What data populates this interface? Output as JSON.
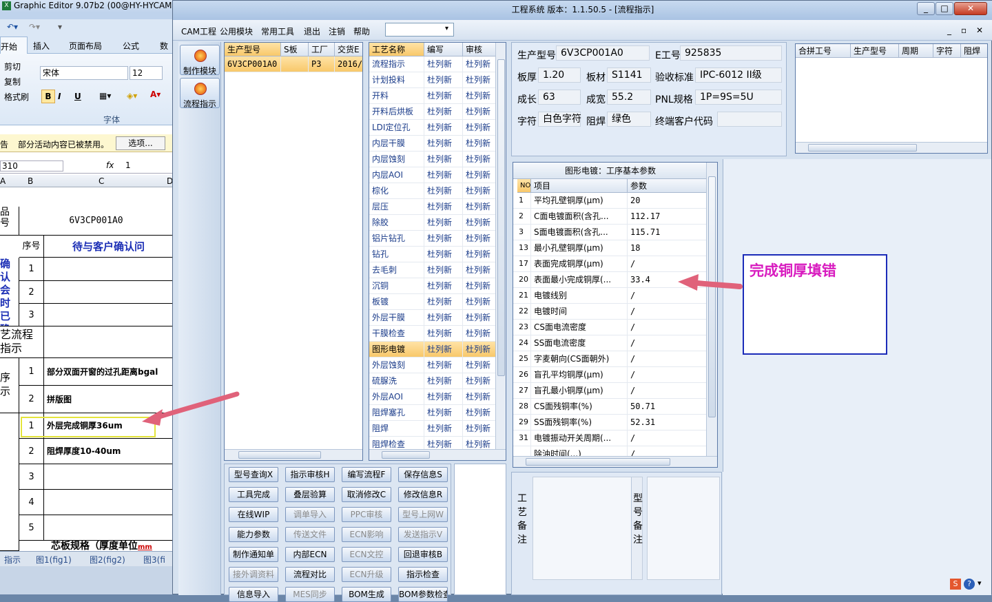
{
  "excel": {
    "title": "Graphic Editor 9.07b2 (00@HY-HYCAM",
    "tabs": [
      "开始",
      "插入",
      "页面布局",
      "公式",
      "数"
    ],
    "clipboard": [
      "剪切",
      "复制",
      "格式刷"
    ],
    "font_name": "宋体",
    "font_size": "12",
    "font_group": "字体",
    "security_msg_prefix": "告",
    "security_msg": "部分活动内容已被禁用。",
    "options_btn": "选项...",
    "namebox": "310",
    "fx": "fx",
    "formula": "1",
    "col_headers": [
      "A",
      "B",
      "C",
      "D"
    ],
    "product_label": "品号",
    "product_value": "6V3CP001A0",
    "seq_header": "序号",
    "pending_header": "待与客户确认问",
    "confirm_label": "确认会时已确问题",
    "confirm_rows": [
      "1",
      "2",
      "3"
    ],
    "flow_label": "艺流程指示",
    "seq_label": "序示",
    "rows_a": [
      {
        "n": "1",
        "t": "部分双面开窗的过孔距离bgal"
      },
      {
        "n": "2",
        "t": "拼版图"
      }
    ],
    "rows_b": [
      {
        "n": "1",
        "t": "外层完成铜厚36um"
      },
      {
        "n": "2",
        "t": "阻焊厚度10-40um"
      },
      {
        "n": "3",
        "t": ""
      },
      {
        "n": "4",
        "t": ""
      },
      {
        "n": "5",
        "t": ""
      }
    ],
    "spec_text": "芯板规格（厚度单位",
    "spec_unit": "mm",
    "sheet_tabs": [
      "指示",
      "图1(fig1)",
      "图2(fig2)",
      "图3(fi"
    ]
  },
  "app": {
    "title": "工程系统   版本：1.1.50.5 - [流程指示]",
    "win_buttons": [
      "_",
      "□",
      "✕"
    ],
    "menu": [
      "CAM工程",
      "公用模块",
      "常用工具",
      "退出",
      "注销",
      "帮助"
    ],
    "mdi_buttons": [
      "_",
      "▫",
      "✕"
    ],
    "left_buttons": [
      "制作模块",
      "流程指示"
    ],
    "orders": {
      "headers": [
        "生产型号",
        "S板",
        "工厂",
        "交货E"
      ],
      "rows": [
        [
          "6V3CP001A0",
          "",
          "P3",
          "2016/"
        ]
      ]
    },
    "process": {
      "headers": [
        "工艺名称",
        "编写",
        "审核"
      ],
      "rows": [
        [
          "流程指示",
          "杜列新",
          "杜列新"
        ],
        [
          "计划投料",
          "杜列新",
          "杜列新"
        ],
        [
          "开料",
          "杜列新",
          "杜列新"
        ],
        [
          "开料后烘板",
          "杜列新",
          "杜列新"
        ],
        [
          "LDI定位孔",
          "杜列新",
          "杜列新"
        ],
        [
          "内层干膜",
          "杜列新",
          "杜列新"
        ],
        [
          "内层蚀刻",
          "杜列新",
          "杜列新"
        ],
        [
          "内层AOI",
          "杜列新",
          "杜列新"
        ],
        [
          "棕化",
          "杜列新",
          "杜列新"
        ],
        [
          "层压",
          "杜列新",
          "杜列新"
        ],
        [
          "除胶",
          "杜列新",
          "杜列新"
        ],
        [
          "铝片钻孔",
          "杜列新",
          "杜列新"
        ],
        [
          "钻孔",
          "杜列新",
          "杜列新"
        ],
        [
          "去毛刺",
          "杜列新",
          "杜列新"
        ],
        [
          "沉铜",
          "杜列新",
          "杜列新"
        ],
        [
          "板镀",
          "杜列新",
          "杜列新"
        ],
        [
          "外层干膜",
          "杜列新",
          "杜列新"
        ],
        [
          "干膜检查",
          "杜列新",
          "杜列新"
        ],
        [
          "图形电镀",
          "杜列新",
          "杜列新"
        ],
        [
          "外层蚀刻",
          "杜列新",
          "杜列新"
        ],
        [
          "硫脲洗",
          "杜列新",
          "杜列新"
        ],
        [
          "外层AOI",
          "杜列新",
          "杜列新"
        ],
        [
          "阻焊塞孔",
          "杜列新",
          "杜列新"
        ],
        [
          "阻焊",
          "杜列新",
          "杜列新"
        ],
        [
          "阻焊检查",
          "杜列新",
          "杜列新"
        ]
      ],
      "selected": 18
    },
    "buttons": [
      [
        {
          "t": "型号查询X",
          "d": false
        },
        {
          "t": "指示审核H",
          "d": false
        },
        {
          "t": "编写流程F",
          "d": false
        },
        {
          "t": "保存信息S",
          "d": false
        }
      ],
      [
        {
          "t": "工具完成",
          "d": false
        },
        {
          "t": "叠层验算",
          "d": false
        },
        {
          "t": "取消修改C",
          "d": false
        },
        {
          "t": "修改信息R",
          "d": false
        }
      ],
      [
        {
          "t": "在线WIP",
          "d": false
        },
        {
          "t": "调单导入",
          "d": true
        },
        {
          "t": "PPC审核",
          "d": true
        },
        {
          "t": "型号上网W",
          "d": true
        }
      ],
      [
        {
          "t": "能力参数",
          "d": false
        },
        {
          "t": "传送文件",
          "d": true
        },
        {
          "t": "ECN影响",
          "d": true
        },
        {
          "t": "发送指示V",
          "d": true
        }
      ],
      [
        {
          "t": "制作通知单",
          "d": false
        },
        {
          "t": "内部ECN",
          "d": false
        },
        {
          "t": "ECN文控",
          "d": true
        },
        {
          "t": "回退审核B",
          "d": false
        }
      ],
      [
        {
          "t": "接外调资料",
          "d": true
        },
        {
          "t": "流程对比",
          "d": false
        },
        {
          "t": "ECN升级",
          "d": true
        },
        {
          "t": "指示检查",
          "d": false
        }
      ],
      [
        {
          "t": "信息导入",
          "d": false
        },
        {
          "t": "MES同步",
          "d": true
        },
        {
          "t": "BOM生成",
          "d": false
        },
        {
          "t": "BOM参数检查",
          "d": false
        }
      ]
    ],
    "info": {
      "model_label": "生产型号",
      "model": "6V3CP001A0",
      "e_label": "E工号",
      "e_no": "925835",
      "thick_label": "板厚",
      "thick": "1.20",
      "mat_label": "板材",
      "mat": "S1141",
      "std_label": "验收标准",
      "std": "IPC-6012 II级",
      "len_label": "成长",
      "len": "63",
      "wid_label": "成宽",
      "wid": "55.2",
      "pnl_label": "PNL规格",
      "pnl": "1P=9S=5U",
      "char_label": "字符",
      "char": "白色字符",
      "mask_label": "阻焊",
      "mask": "绿色",
      "cust_label": "终端客户代码",
      "cust": ""
    },
    "merge_headers": [
      "合拼工号",
      "生产型号",
      "周期",
      "字符",
      "阻焊"
    ],
    "params": {
      "title": "图形电镀：工序基本参数",
      "headers": [
        "NO",
        "项目",
        "参数"
      ],
      "rows": [
        [
          "1",
          "平均孔壁铜厚(μm)",
          "20"
        ],
        [
          "2",
          "C面电镀面积(含孔...",
          "112.17"
        ],
        [
          "3",
          "S面电镀面积(含孔...",
          "115.71"
        ],
        [
          "13",
          "最小孔壁铜厚(μm)",
          "18"
        ],
        [
          "17",
          "表面完成铜厚(μm)",
          "/"
        ],
        [
          "20",
          "表面最小完成铜厚(...",
          "33.4"
        ],
        [
          "21",
          "电镀线别",
          "/"
        ],
        [
          "22",
          "电镀时间",
          "/"
        ],
        [
          "23",
          "CS面电流密度",
          "/"
        ],
        [
          "24",
          "SS面电流密度",
          "/"
        ],
        [
          "25",
          "字麦朝向(CS面朝外)",
          "/"
        ],
        [
          "26",
          "盲孔平均铜厚(μm)",
          "/"
        ],
        [
          "27",
          "盲孔最小铜厚(μm)",
          "/"
        ],
        [
          "28",
          "CS面残铜率(%)",
          "50.71"
        ],
        [
          "29",
          "SS面残铜率(%)",
          "52.31"
        ],
        [
          "31",
          "电镀振动开关周期(...",
          "/"
        ],
        [
          "",
          "除油时间(...)",
          "/"
        ]
      ]
    },
    "remark_labels": [
      "工艺备注",
      "型号备注"
    ],
    "annotation": "完成铜厚填错",
    "accent": "#d81bbf"
  }
}
